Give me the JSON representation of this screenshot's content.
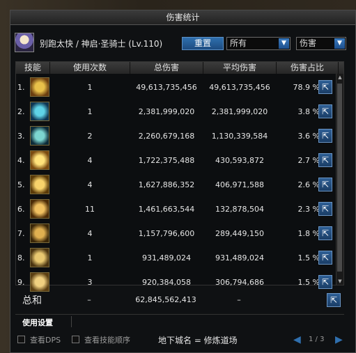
{
  "title": "伤害统计",
  "character": {
    "name": "别跑太快 / 神启·圣骑士 (Lv.110)"
  },
  "controls": {
    "reset_label": "重置",
    "filter_value": "所有",
    "metric_value": "伤害"
  },
  "columns": [
    "技能",
    "使用次数",
    "总伤害",
    "平均伤害",
    "伤害占比"
  ],
  "rows": [
    {
      "n": "1.",
      "uses": "1",
      "total": "49,613,735,456",
      "avg": "49,613,735,456",
      "pct": "78.9",
      "c1": "#e8c14a",
      "c2": "#6a3d10"
    },
    {
      "n": "2.",
      "uses": "1",
      "total": "2,381,999,020",
      "avg": "2,381,999,020",
      "pct": "3.8",
      "c1": "#5fd3e6",
      "c2": "#0f3552"
    },
    {
      "n": "3.",
      "uses": "2",
      "total": "2,260,679,168",
      "avg": "1,130,339,584",
      "pct": "3.6",
      "c1": "#7cd6d0",
      "c2": "#0c2a38"
    },
    {
      "n": "4.",
      "uses": "4",
      "total": "1,722,375,488",
      "avg": "430,593,872",
      "pct": "2.7",
      "c1": "#ffe27a",
      "c2": "#7a4a10"
    },
    {
      "n": "5.",
      "uses": "4",
      "total": "1,627,886,352",
      "avg": "406,971,588",
      "pct": "2.6",
      "c1": "#f7d36b",
      "c2": "#5a3a08"
    },
    {
      "n": "6.",
      "uses": "11",
      "total": "1,461,663,544",
      "avg": "132,878,504",
      "pct": "2.3",
      "c1": "#f0c060",
      "c2": "#4a2a06"
    },
    {
      "n": "7.",
      "uses": "4",
      "total": "1,157,796,600",
      "avg": "289,449,150",
      "pct": "1.8",
      "c1": "#e0b050",
      "c2": "#3a2608"
    },
    {
      "n": "8.",
      "uses": "1",
      "total": "931,489,024",
      "avg": "931,489,024",
      "pct": "1.5",
      "c1": "#e8c870",
      "c2": "#4a3410"
    },
    {
      "n": "9.",
      "uses": "3",
      "total": "920,384,058",
      "avg": "306,794,686",
      "pct": "1.5",
      "c1": "#f0d080",
      "c2": "#5a3e12"
    }
  ],
  "pct_unit": "%",
  "total": {
    "label": "总和",
    "uses": "–",
    "total": "62,845,562,413",
    "avg": "–"
  },
  "settings_label": "使用设置",
  "footer": {
    "view_dps": "查看DPS",
    "view_skill_order": "查看技能顺序",
    "dungeon": "地下城名 = 修炼道场",
    "page": "1 / 3"
  }
}
